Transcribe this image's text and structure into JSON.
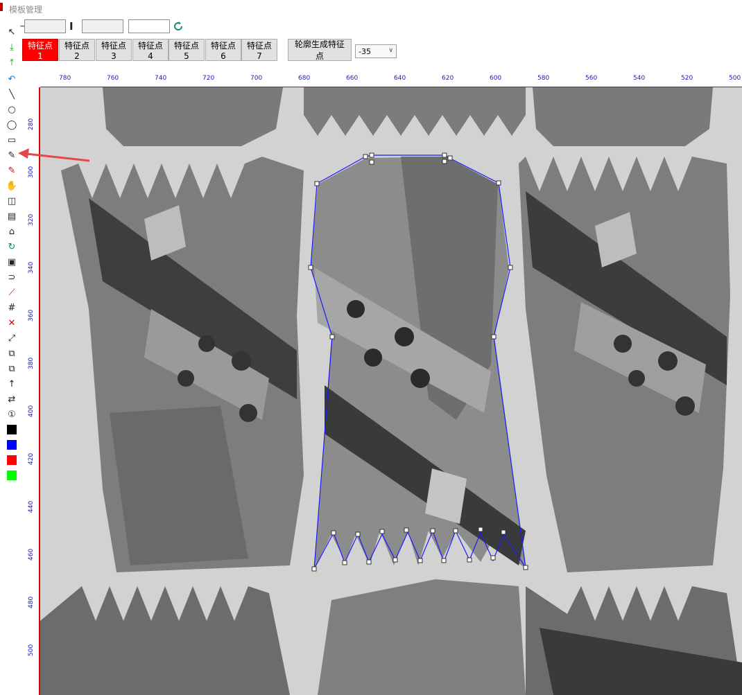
{
  "window": {
    "title": "模板管理"
  },
  "toolbar": {
    "field1_value": "",
    "field2_value": "",
    "field3_value": "",
    "refresh_icon": "refresh-icon"
  },
  "feature_buttons": [
    "特征点1",
    "特征点2",
    "特征点3",
    "特征点4",
    "特征点5",
    "特征点6",
    "特征点7"
  ],
  "contour_button": "轮廓生成特征点",
  "angle_select": {
    "value": "-35"
  },
  "ruler": {
    "x_labels": [
      "780",
      "760",
      "740",
      "720",
      "700",
      "680",
      "660",
      "640",
      "620",
      "600",
      "580",
      "560",
      "540",
      "520",
      "500"
    ],
    "y_labels": [
      "280",
      "300",
      "320",
      "340",
      "360",
      "380",
      "400",
      "420",
      "440",
      "460",
      "480",
      "500"
    ]
  },
  "colors": {
    "accent": "#ff0000",
    "outline": "#1a1aff",
    "swatch_black": "#000000",
    "swatch_blue": "#0000ff",
    "swatch_red": "#ff0000",
    "swatch_green": "#00ff00"
  }
}
